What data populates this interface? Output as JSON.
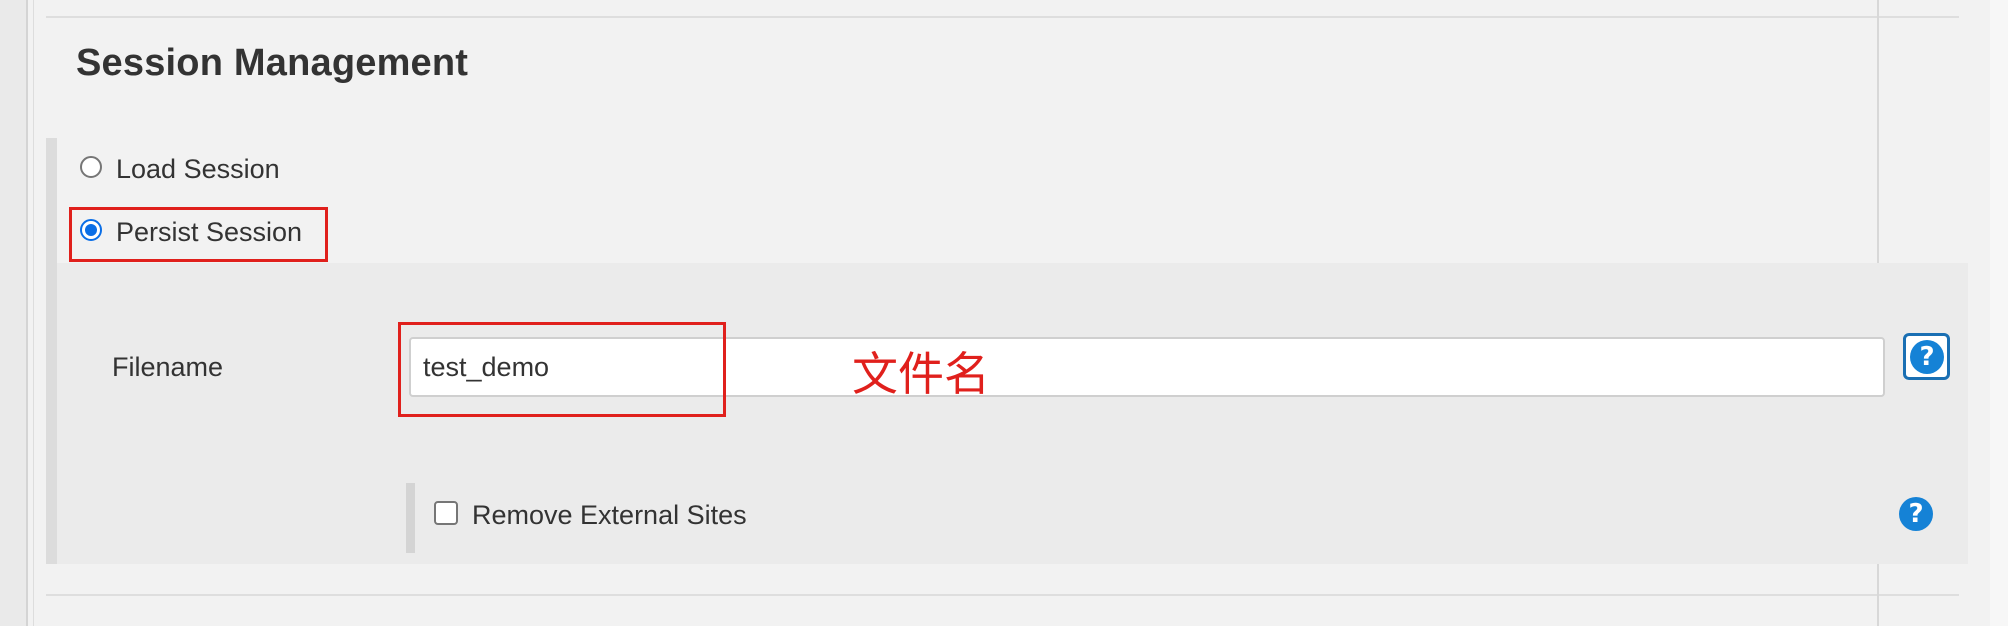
{
  "section": {
    "title": "Session Management"
  },
  "radio_options": [
    {
      "label": "Load Session",
      "checked": false
    },
    {
      "label": "Persist Session",
      "checked": true
    }
  ],
  "filename": {
    "label": "Filename",
    "value": "test_demo",
    "annotation": "文件名"
  },
  "remove_external": {
    "label": "Remove External Sites",
    "checked": false
  },
  "help": {
    "symbol": "?"
  },
  "colors": {
    "annotation_red": "#e0201c",
    "radio_blue": "#0a6ee6",
    "help_blue": "#1582d6"
  }
}
